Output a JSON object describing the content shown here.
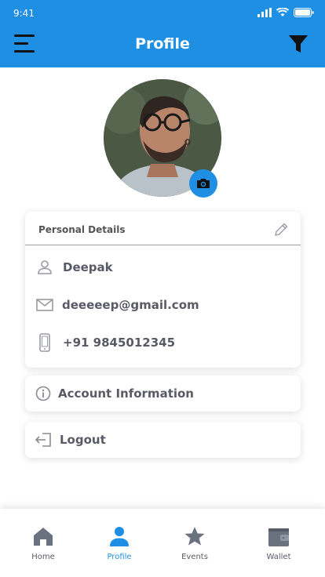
{
  "status_bar": {
    "time": "9:41"
  },
  "header": {
    "title": "Profile"
  },
  "profile": {
    "details_title": "Personal Details",
    "name": "Deepak",
    "email": "deeeeep@gmail.com",
    "phone": "+91 9845012345"
  },
  "actions": {
    "account_info": "Account Information",
    "logout": "Logout"
  },
  "bottom_nav": {
    "items": [
      {
        "label": "Home",
        "icon": "home-icon"
      },
      {
        "label": "Profile",
        "icon": "person-icon"
      },
      {
        "label": "Events",
        "icon": "star-icon"
      },
      {
        "label": "Wallet",
        "icon": "wallet-icon"
      }
    ],
    "active_index": 1
  },
  "colors": {
    "accent": "#1e8fe3",
    "text": "#5a5a66",
    "icon": "#6a7280"
  }
}
